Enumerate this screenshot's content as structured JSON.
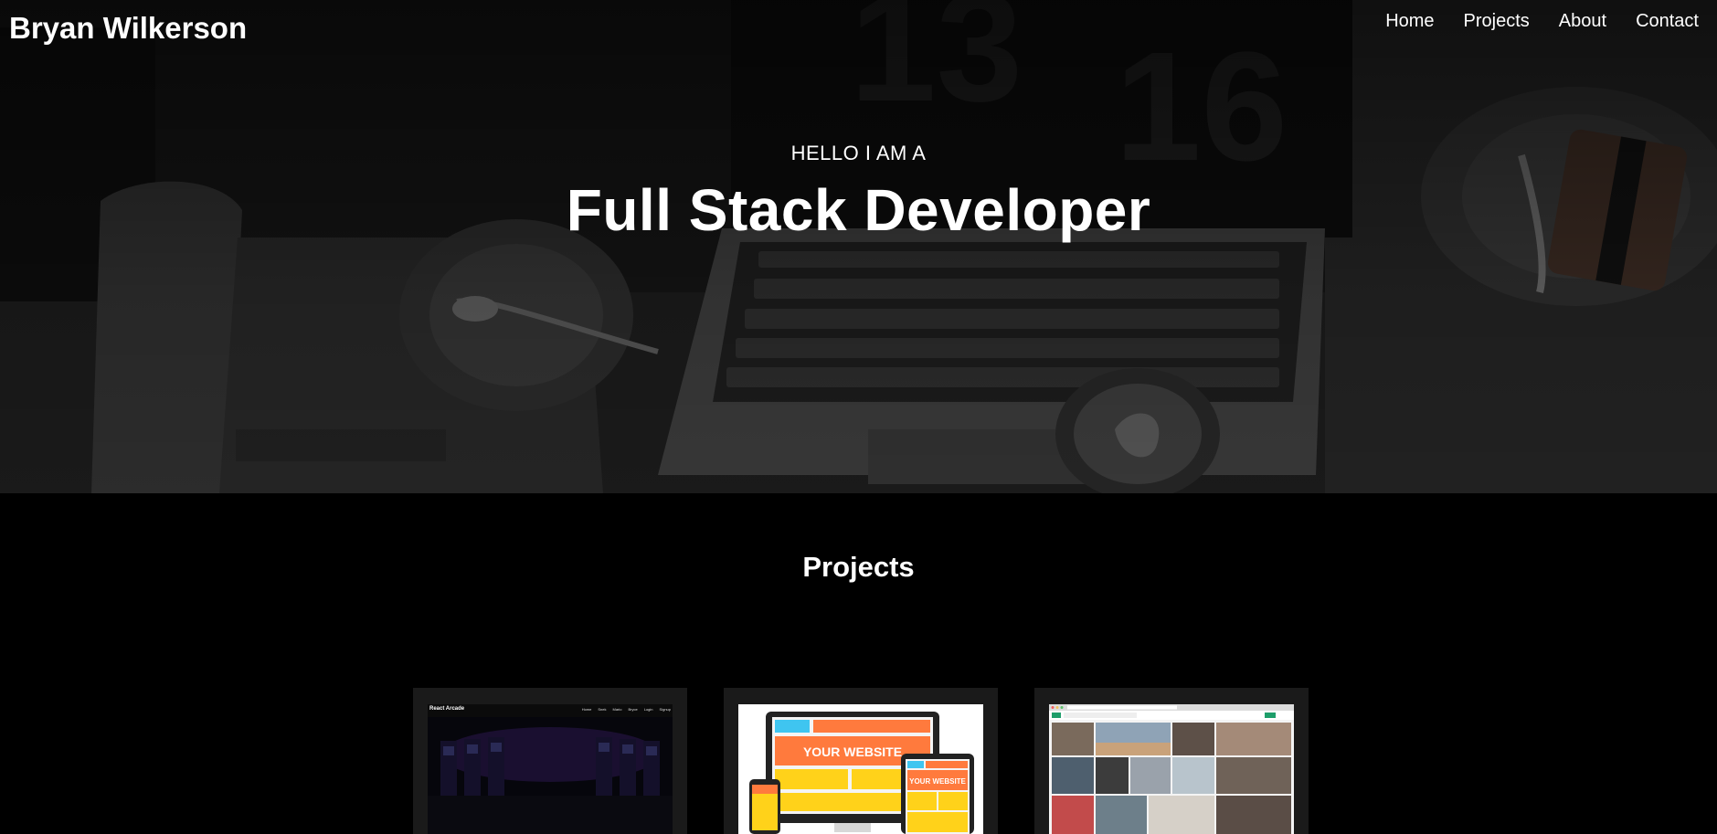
{
  "nav": {
    "brand": "Bryan Wilkerson",
    "links": [
      {
        "label": "Home"
      },
      {
        "label": "Projects"
      },
      {
        "label": "About"
      },
      {
        "label": "Contact"
      }
    ]
  },
  "hero": {
    "kicker": "HELLO I AM A",
    "title": "Full Stack Developer"
  },
  "projects": {
    "heading": "Projects",
    "cards": [
      {
        "thumbnail": "arcade-screenshot",
        "thumb_title": "React Arcade",
        "thumb_nav": [
          "Home",
          "Snek",
          "Mario",
          "Bryce",
          "Login",
          "Signup"
        ]
      },
      {
        "thumbnail": "your-website-illustration",
        "thumb_text": "YOUR WEBSITE",
        "thumb_text_small": "YOUR WEBSITE"
      },
      {
        "thumbnail": "photo-gallery-screenshot"
      }
    ]
  },
  "colors": {
    "background": "#000000",
    "card": "#1a1a1a",
    "text": "#ffffff",
    "site_orange": "#ff7a3d",
    "site_yellow": "#ffd21a",
    "site_blue": "#3fc5f0",
    "gallery_accent": "#1e9e6a"
  }
}
